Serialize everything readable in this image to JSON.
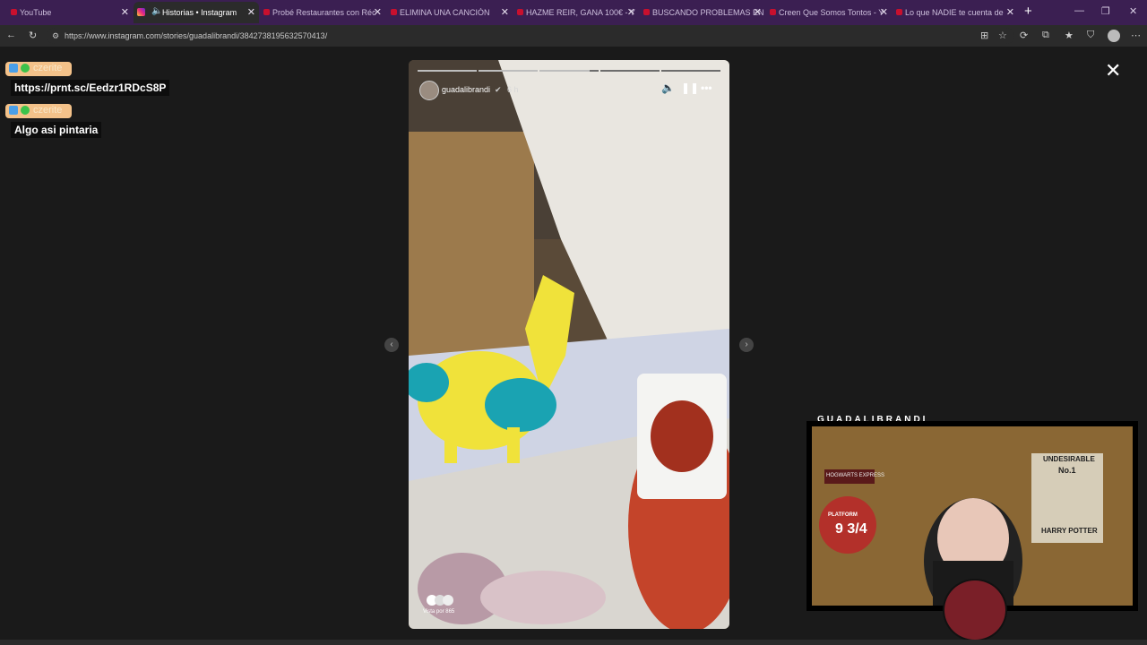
{
  "browser": {
    "tabs": [
      {
        "label": "YouTube",
        "icon": "youtube-icon"
      },
      {
        "label": "Historias • Instagram",
        "icon": "instagram-icon"
      },
      {
        "label": "Probé Restaurantes con Réc",
        "icon": "youtube-icon"
      },
      {
        "label": "ELIMINA UNA CANCIÓN",
        "icon": "youtube-icon"
      },
      {
        "label": "HAZME REIR, GANA 100€ - Y",
        "icon": "youtube-icon"
      },
      {
        "label": "BUSCANDO PROBLEMAS EN",
        "icon": "youtube-icon"
      },
      {
        "label": "Creen Que Somos Tontos - Y",
        "icon": "youtube-icon"
      },
      {
        "label": "Lo que NADIE te cuenta de",
        "icon": "youtube-icon"
      }
    ],
    "url": "https://www.instagram.com/stories/guadalibrandi/3842738195632570413/",
    "new_tab": "+"
  },
  "chat": [
    {
      "user": "czerite",
      "message": "https://prnt.sc/Eedzr1RDcS8P"
    },
    {
      "user": "czerite",
      "message": "Algo asi pintaria"
    }
  ],
  "story": {
    "username": "guadalibrandi",
    "time": "6 h",
    "views": "Vista por 865",
    "progress_segments": 5,
    "active_segment": 3
  },
  "webcam": {
    "label": "GUADALIBRANDI",
    "poster_lines": [
      "UNDESIRABLE",
      "No.1",
      "HARRY POTTER"
    ],
    "sign_lines": [
      "HOGWARTS EXPRESS",
      "PLATFORM",
      "9 3/4"
    ]
  },
  "colors": {
    "tabbar": "#3b1f52",
    "accent": "#c8102e"
  }
}
